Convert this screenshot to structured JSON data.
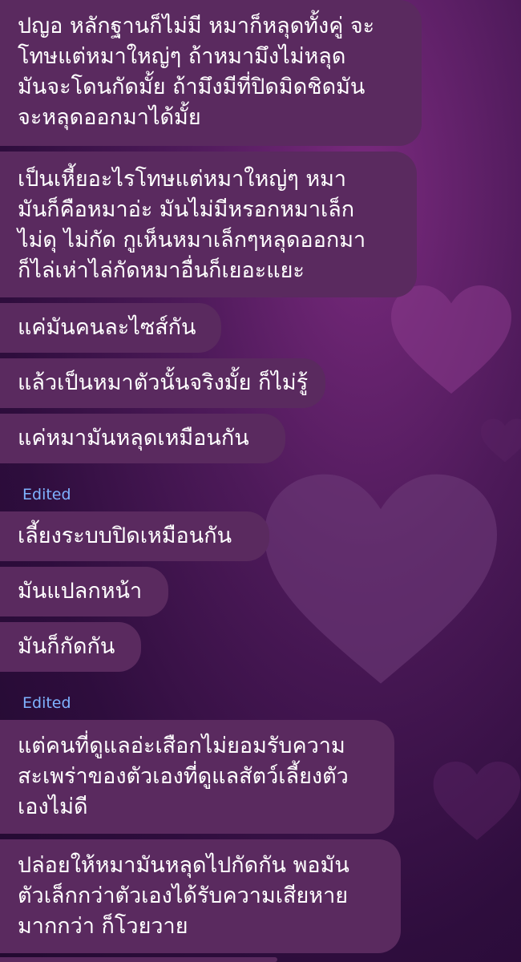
{
  "theme": {
    "bubble_color": "#5a2a5f",
    "edited_color": "#7fb3ff",
    "background": "#3a1248"
  },
  "messages": [
    {
      "lines": [
        "ปญอ หลักฐานก็ไม่มี หมาก็หลุดทั้งคู่ จะ",
        "โทษแต่หมาใหญ่ๆ ถ้าหมามึงไม่หลุด",
        "มันจะโดนกัดมั้ย ถ้ามึงมีที่ปิดมิดชิดมัน",
        "จะหลุดออกมาได้มั้ย"
      ]
    },
    {
      "lines": [
        "เป็นเหี้ยอะไรโทษแต่หมาใหญ่ๆ หมา",
        "มันก็คือหมาอ่ะ มันไม่มีหรอกหมาเล็ก",
        "ไม่ดุ ไม่กัด กูเห็นหมาเล็กๆหลุดออกมา",
        "ก็ไล่เห่าไล่กัดหมาอื่นก็เยอะแยะ"
      ]
    },
    {
      "lines": [
        "แค่มันคนละไซส์กัน"
      ]
    },
    {
      "lines": [
        "แล้วเป็นหมาตัวนั้นจริงมั้ย ก็ไม่รู้"
      ]
    },
    {
      "lines": [
        "แค่หมามันหลุดเหมือนกัน"
      ]
    },
    {
      "lines": [
        "เลี้ยงระบบปิดเหมือนกัน"
      ]
    },
    {
      "lines": [
        "มันแปลกหน้า"
      ]
    },
    {
      "lines": [
        "มันก็กัดกัน"
      ]
    },
    {
      "lines": [
        "แต่คนที่ดูแลอ่ะเสือกไม่ยอมรับความ",
        "สะเพร่าของตัวเองที่ดูแลสัตว์เลี้ยงตัว",
        "เองไม่ดี"
      ]
    },
    {
      "lines": [
        "ปล่อยให้หมามันหลุดไปกัดกัน พอมัน",
        "ตัวเล็กกว่าตัวเองได้รับความเสียหาย",
        "มากกว่า ก็โวยวาย"
      ]
    }
  ],
  "edited_label": "Edited"
}
